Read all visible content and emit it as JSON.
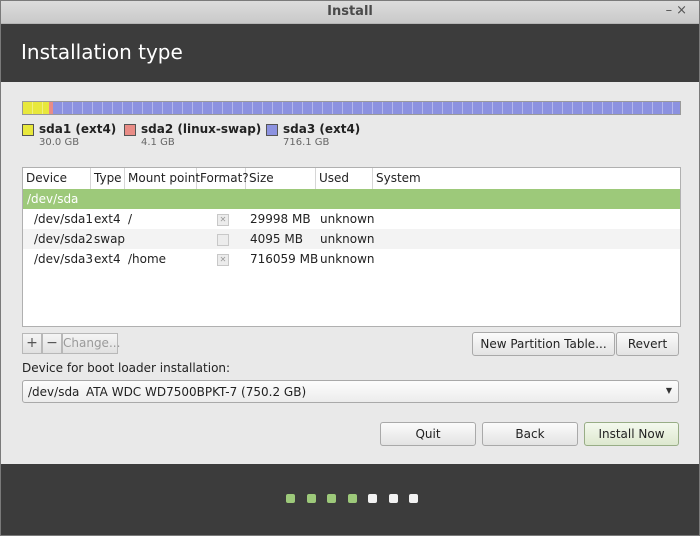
{
  "window": {
    "title": "Install",
    "minimize_glyph": "–",
    "close_glyph": "×"
  },
  "header": {
    "title": "Installation type"
  },
  "partition_bar": [
    {
      "name": "sda1 (ext4)",
      "size": "30.0 GB",
      "color": "#e8e83c",
      "fraction": 0.04
    },
    {
      "name": "sda2 (linux-swap)",
      "size": "4.1 GB",
      "color": "#e98c86",
      "fraction": 0.006
    },
    {
      "name": "sda3 (ext4)",
      "size": "716.1 GB",
      "color": "#8c92e0",
      "fraction": 0.954
    }
  ],
  "table": {
    "columns": [
      "Device",
      "Type",
      "Mount point",
      "Format?",
      "Size",
      "Used",
      "System"
    ],
    "disk_row": "/dev/sda",
    "rows": [
      {
        "device": "/dev/sda1",
        "type": "ext4",
        "mount": "/",
        "format": true,
        "size": "29998 MB",
        "used": "unknown",
        "system": ""
      },
      {
        "device": "/dev/sda2",
        "type": "swap",
        "mount": "",
        "format": false,
        "size": "4095 MB",
        "used": "unknown",
        "system": ""
      },
      {
        "device": "/dev/sda3",
        "type": "ext4",
        "mount": "/home",
        "format": true,
        "size": "716059 MB",
        "used": "unknown",
        "system": ""
      }
    ]
  },
  "toolbar": {
    "add": "+",
    "remove": "−",
    "change": "Change...",
    "new_table": "New Partition Table...",
    "revert": "Revert"
  },
  "boot_loader": {
    "label": "Device for boot loader installation:",
    "device": "/dev/sda",
    "description": "ATA WDC WD7500BPKT-7 (750.2 GB)"
  },
  "actions": {
    "quit": "Quit",
    "back": "Back",
    "install": "Install Now"
  },
  "progress": {
    "total_steps": 7,
    "completed_steps": 4,
    "active_color": "#9dc97a",
    "inactive_color": "#f2f2f2"
  }
}
